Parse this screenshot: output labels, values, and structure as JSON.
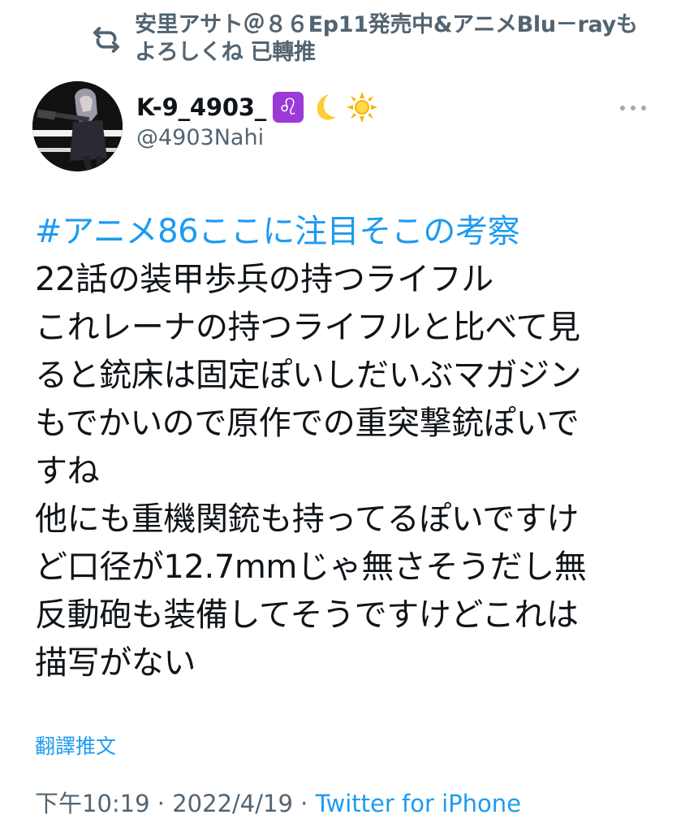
{
  "retweet": {
    "text": "安里アサト＠８６Ep11発売中&アニメBlu－rayもよろしくね 已轉推",
    "icon": "retweet-icon"
  },
  "author": {
    "display_name": "K-9_4903_",
    "leo_glyph": "♌",
    "handle": "@4903Nahi",
    "emojis": [
      "leo-icon",
      "crescent-moon-icon",
      "sun-icon"
    ]
  },
  "tweet": {
    "lines": [
      "#アニメ86ここに注目そこの考察",
      "22話の装甲歩兵の持つライフル",
      "これレーナの持つライフルと比べて見",
      "ると銃床は固定ぽいしだいぶマガジン",
      "もでかいので原作での重突撃銃ぽいで",
      "すね",
      "他にも重機関銃も持ってるぽいですけ",
      "ど口径が12.7mmじゃ無さそうだし無",
      "反動砲も装備してそうですけどこれは",
      "描写がない"
    ],
    "translate_label": "翻譯推文"
  },
  "meta": {
    "time": "下午10:19",
    "separator": " · ",
    "date": "2022/4/19",
    "source": "Twitter for iPhone"
  },
  "colors": {
    "link": "#1d9bf0",
    "secondary": "#536471",
    "text": "#0f1419",
    "leo_bg": "#9b3ad6"
  }
}
